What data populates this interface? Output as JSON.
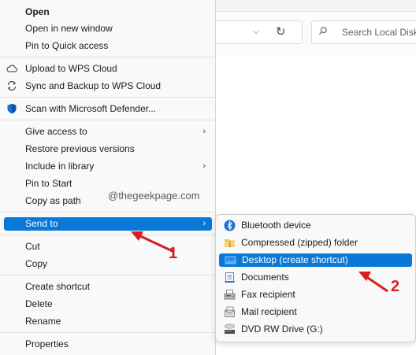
{
  "explorer": {
    "search_placeholder": "Search Local Disk"
  },
  "context_menu": {
    "items": [
      {
        "label": "Open",
        "icon": "none",
        "bold": true
      },
      {
        "label": "Open in new window",
        "icon": "none"
      },
      {
        "label": "Pin to Quick access",
        "icon": "none"
      },
      {
        "label": "Upload to WPS Cloud",
        "icon": "cloud-icon"
      },
      {
        "label": "Sync and Backup to WPS Cloud",
        "icon": "sync-icon"
      },
      {
        "label": "Scan with Microsoft Defender...",
        "icon": "defender-shield-icon"
      },
      {
        "label": "Give access to",
        "icon": "none",
        "submenu": true
      },
      {
        "label": "Restore previous versions",
        "icon": "none"
      },
      {
        "label": "Include in library",
        "icon": "none",
        "submenu": true
      },
      {
        "label": "Pin to Start",
        "icon": "none"
      },
      {
        "label": "Copy as path",
        "icon": "none"
      },
      {
        "label": "Send to",
        "icon": "none",
        "submenu": true,
        "selected": true
      },
      {
        "label": "Cut",
        "icon": "none"
      },
      {
        "label": "Copy",
        "icon": "none"
      },
      {
        "label": "Create shortcut",
        "icon": "none"
      },
      {
        "label": "Delete",
        "icon": "none"
      },
      {
        "label": "Rename",
        "icon": "none"
      },
      {
        "label": "Properties",
        "icon": "none"
      }
    ],
    "chevron": "›"
  },
  "send_to_submenu": {
    "items": [
      {
        "label": "Bluetooth device",
        "icon": "bluetooth-icon"
      },
      {
        "label": "Compressed (zipped) folder",
        "icon": "zip-folder-icon"
      },
      {
        "label": "Desktop (create shortcut)",
        "icon": "desktop-icon",
        "selected": true
      },
      {
        "label": "Documents",
        "icon": "documents-icon"
      },
      {
        "label": "Fax recipient",
        "icon": "fax-icon"
      },
      {
        "label": "Mail recipient",
        "icon": "mail-icon"
      },
      {
        "label": "DVD RW Drive (G:)",
        "icon": "dvd-drive-icon"
      }
    ]
  },
  "watermark": "@thegeekpage.com",
  "annotations": {
    "step1": "1",
    "step2": "2",
    "color": "#d81e1e"
  },
  "colors": {
    "selection": "#0a78d7",
    "menu_bg": "#f9f9f9"
  }
}
